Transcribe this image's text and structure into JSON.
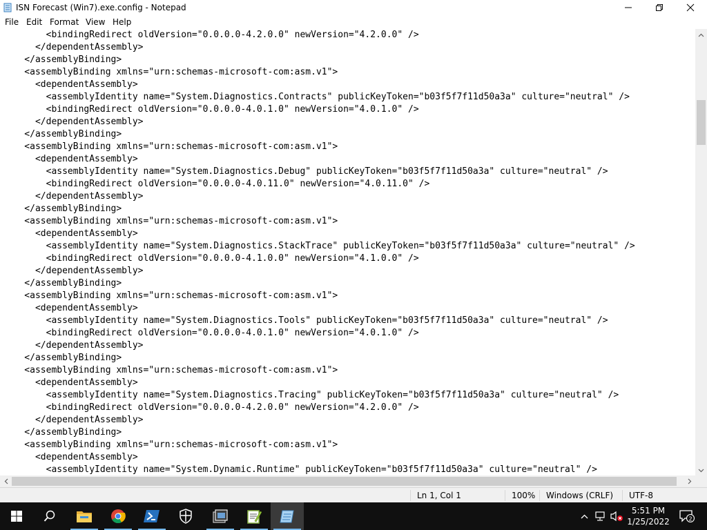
{
  "window": {
    "title": "ISN Forecast (Win7).exe.config - Notepad"
  },
  "menu": {
    "file": "File",
    "edit": "Edit",
    "format": "Format",
    "view": "View",
    "help": "Help"
  },
  "editor": {
    "lines": [
      "        <bindingRedirect oldVersion=\"0.0.0.0-4.2.0.0\" newVersion=\"4.2.0.0\" />",
      "      </dependentAssembly>",
      "    </assemblyBinding>",
      "    <assemblyBinding xmlns=\"urn:schemas-microsoft-com:asm.v1\">",
      "      <dependentAssembly>",
      "        <assemblyIdentity name=\"System.Diagnostics.Contracts\" publicKeyToken=\"b03f5f7f11d50a3a\" culture=\"neutral\" />",
      "        <bindingRedirect oldVersion=\"0.0.0.0-4.0.1.0\" newVersion=\"4.0.1.0\" />",
      "      </dependentAssembly>",
      "    </assemblyBinding>",
      "    <assemblyBinding xmlns=\"urn:schemas-microsoft-com:asm.v1\">",
      "      <dependentAssembly>",
      "        <assemblyIdentity name=\"System.Diagnostics.Debug\" publicKeyToken=\"b03f5f7f11d50a3a\" culture=\"neutral\" />",
      "        <bindingRedirect oldVersion=\"0.0.0.0-4.0.11.0\" newVersion=\"4.0.11.0\" />",
      "      </dependentAssembly>",
      "    </assemblyBinding>",
      "    <assemblyBinding xmlns=\"urn:schemas-microsoft-com:asm.v1\">",
      "      <dependentAssembly>",
      "        <assemblyIdentity name=\"System.Diagnostics.StackTrace\" publicKeyToken=\"b03f5f7f11d50a3a\" culture=\"neutral\" />",
      "        <bindingRedirect oldVersion=\"0.0.0.0-4.1.0.0\" newVersion=\"4.1.0.0\" />",
      "      </dependentAssembly>",
      "    </assemblyBinding>",
      "    <assemblyBinding xmlns=\"urn:schemas-microsoft-com:asm.v1\">",
      "      <dependentAssembly>",
      "        <assemblyIdentity name=\"System.Diagnostics.Tools\" publicKeyToken=\"b03f5f7f11d50a3a\" culture=\"neutral\" />",
      "        <bindingRedirect oldVersion=\"0.0.0.0-4.0.1.0\" newVersion=\"4.0.1.0\" />",
      "      </dependentAssembly>",
      "    </assemblyBinding>",
      "    <assemblyBinding xmlns=\"urn:schemas-microsoft-com:asm.v1\">",
      "      <dependentAssembly>",
      "        <assemblyIdentity name=\"System.Diagnostics.Tracing\" publicKeyToken=\"b03f5f7f11d50a3a\" culture=\"neutral\" />",
      "        <bindingRedirect oldVersion=\"0.0.0.0-4.2.0.0\" newVersion=\"4.2.0.0\" />",
      "      </dependentAssembly>",
      "    </assemblyBinding>",
      "    <assemblyBinding xmlns=\"urn:schemas-microsoft-com:asm.v1\">",
      "      <dependentAssembly>",
      "        <assemblyIdentity name=\"System.Dynamic.Runtime\" publicKeyToken=\"b03f5f7f11d50a3a\" culture=\"neutral\" />"
    ]
  },
  "status": {
    "position": "Ln 1, Col 1",
    "zoom": "100%",
    "line_ending": "Windows (CRLF)",
    "encoding": "UTF-8"
  },
  "taskbar": {
    "apps": [
      "start-icon",
      "search-icon",
      "file-explorer-icon",
      "chrome-icon",
      "powershell-icon",
      "security-icon",
      "task-view-icon",
      "notepad-plus-icon",
      "notepad-icon"
    ],
    "time": "5:51 PM",
    "date": "1/25/2022",
    "notification_count": "2",
    "colors": {
      "taskbar_bg": "#101010",
      "active_indicator": "#76b9ed"
    }
  }
}
